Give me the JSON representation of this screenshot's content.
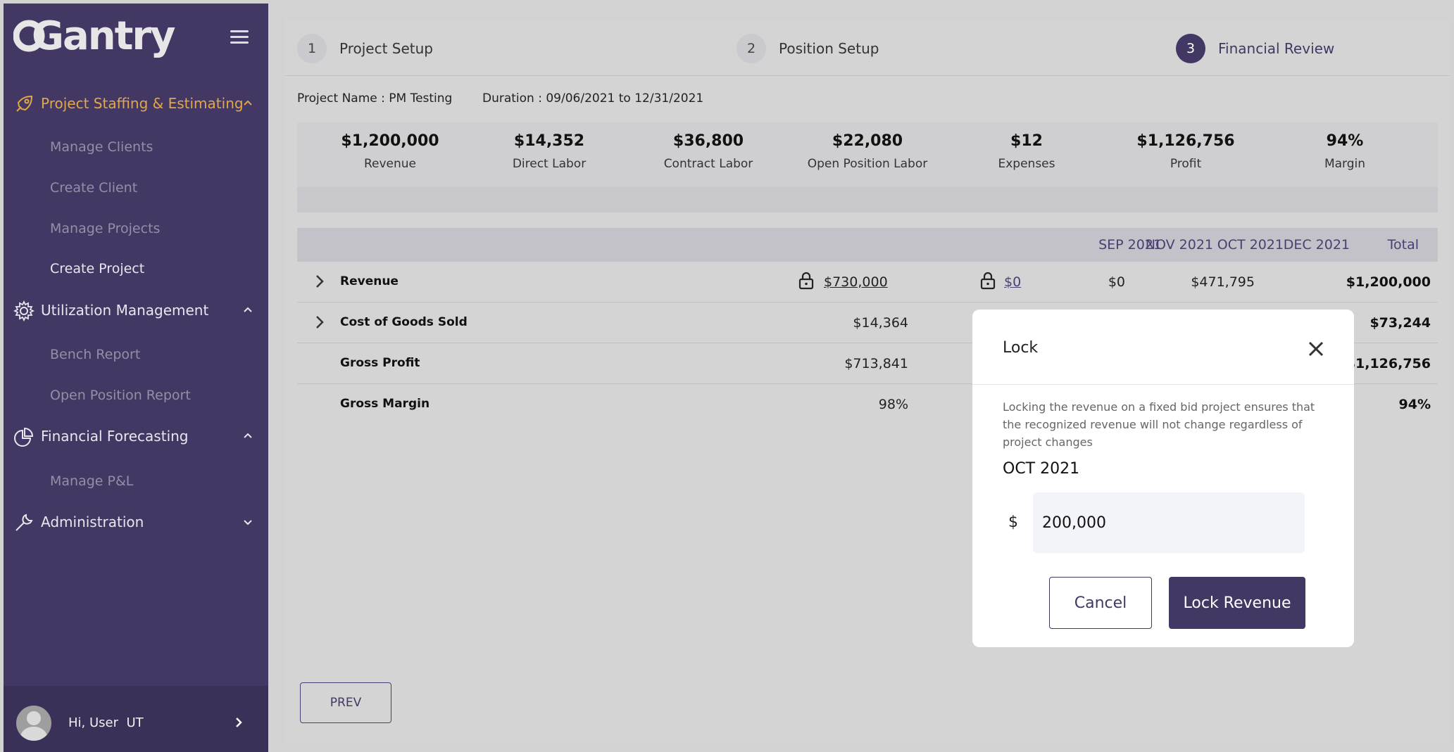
{
  "app": {
    "logo_text": "Gantry"
  },
  "sidebar": {
    "sections": [
      {
        "label": "Project Staffing & Estimating",
        "icon": "rocket-icon",
        "expanded": true,
        "color": "#e0a84a"
      },
      {
        "label": "Utilization Management",
        "icon": "gear-icon",
        "expanded": true
      },
      {
        "label": "Financial Forecasting",
        "icon": "pie-chart-icon",
        "expanded": true
      },
      {
        "label": "Administration",
        "icon": "wrench-icon",
        "expanded": false
      }
    ],
    "project_items": [
      "Manage Clients",
      "Create Client",
      "Manage Projects",
      "Create Project"
    ],
    "utilization_items": [
      "Bench Report",
      "Open Position Report"
    ],
    "financial_items": [
      "Manage P&L"
    ],
    "user": {
      "greeting": "Hi, User",
      "initials": "UT"
    }
  },
  "stepper": {
    "steps": [
      {
        "num": "1",
        "label": "Project Setup",
        "active": false
      },
      {
        "num": "2",
        "label": "Position Setup",
        "active": false
      },
      {
        "num": "3",
        "label": "Financial Review",
        "active": true
      }
    ]
  },
  "project": {
    "name": "Project Name : PM Testing",
    "duration": "Duration : 09/06/2021 to 12/31/2021"
  },
  "summary": [
    {
      "value": "$1,200,000",
      "label": "Revenue"
    },
    {
      "value": "$14,352",
      "label": "Direct Labor"
    },
    {
      "value": "$36,800",
      "label": "Contract Labor"
    },
    {
      "value": "$22,080",
      "label": "Open Position Labor"
    },
    {
      "value": "$12",
      "label": "Expenses"
    },
    {
      "value": "$1,126,756",
      "label": "Profit"
    },
    {
      "value": "94%",
      "label": "Margin"
    }
  ],
  "table": {
    "columns": [
      "SEP 2021",
      "OCT 2021",
      "NOV 2021",
      "DEC 2021",
      "Total"
    ],
    "rows": [
      {
        "name": "Revenue",
        "sep": "$730,000",
        "oct": "$0",
        "nov": "$0",
        "dec": "$471,795",
        "total": "$1,200,000"
      },
      {
        "name": "Cost of Goods Sold",
        "sep": "$14,364",
        "total": "$73,244"
      },
      {
        "name": "Gross Profit",
        "sep": "$713,841",
        "total": "$1,126,756"
      },
      {
        "name": "Gross Margin",
        "sep": "98%",
        "total": "94%"
      }
    ]
  },
  "buttons": {
    "prev": "PREV"
  },
  "modal": {
    "title": "Lock",
    "description": "Locking the revenue on a fixed bid project ensures that the recognized revenue will not change regardless of project changes",
    "month": "OCT 2021",
    "currency": "$",
    "amount": "200,000",
    "cancel": "Cancel",
    "confirm": "Lock Revenue"
  },
  "colors": {
    "sidebar": "#433764",
    "accent": "#e0a84a",
    "primary": "#433764"
  }
}
